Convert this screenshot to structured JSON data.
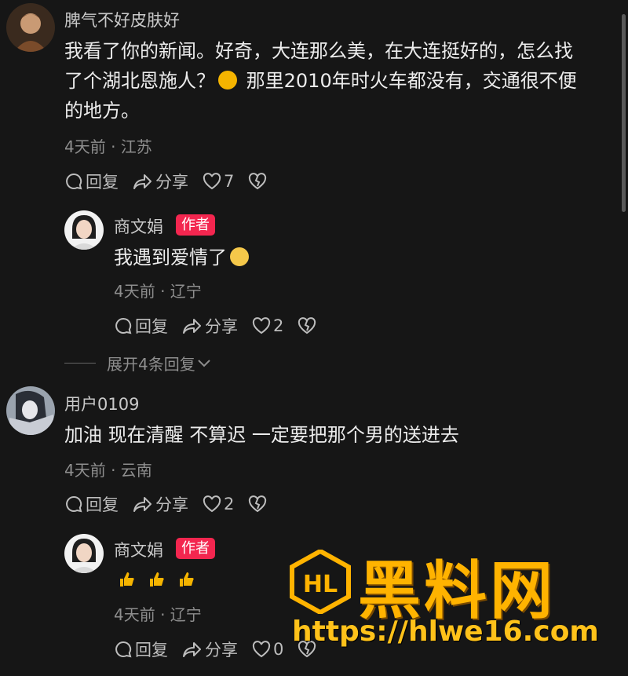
{
  "comments": [
    {
      "username": "脾气不好皮肤好",
      "text_line1": "我看了你的新闻。好奇，大连那么美，在大连挺好的，怎么找",
      "text_line2a": "了个湖北恩施人？",
      "text_line2b": "那里2010年时火车都没有，交通很不便",
      "text_line3": "的地方。",
      "meta": "4天前 · 江苏",
      "reply_label": "回复",
      "share_label": "分享",
      "likes": "7"
    },
    {
      "username": "商文娟",
      "tag": "作者",
      "text": "我遇到爱情了",
      "meta": "4天前 · 辽宁",
      "reply_label": "回复",
      "share_label": "分享",
      "likes": "2"
    },
    {
      "username": "用户0109",
      "text": "加油 现在清醒 不算迟 一定要把那个男的送进去",
      "meta": "4天前 · 云南",
      "reply_label": "回复",
      "share_label": "分享",
      "likes": "2"
    },
    {
      "username": "商文娟",
      "tag": "作者",
      "meta": "4天前 · 辽宁",
      "reply_label": "回复",
      "share_label": "分享",
      "likes": "0"
    }
  ],
  "expand_label": "展开4条回复",
  "watermark": {
    "title": "黑料网",
    "url": "https://hlwe16.com",
    "logo_text": "HL"
  },
  "colors": {
    "background": "#161616",
    "author_tag": "#f3264f",
    "watermark": "#ffb300"
  }
}
